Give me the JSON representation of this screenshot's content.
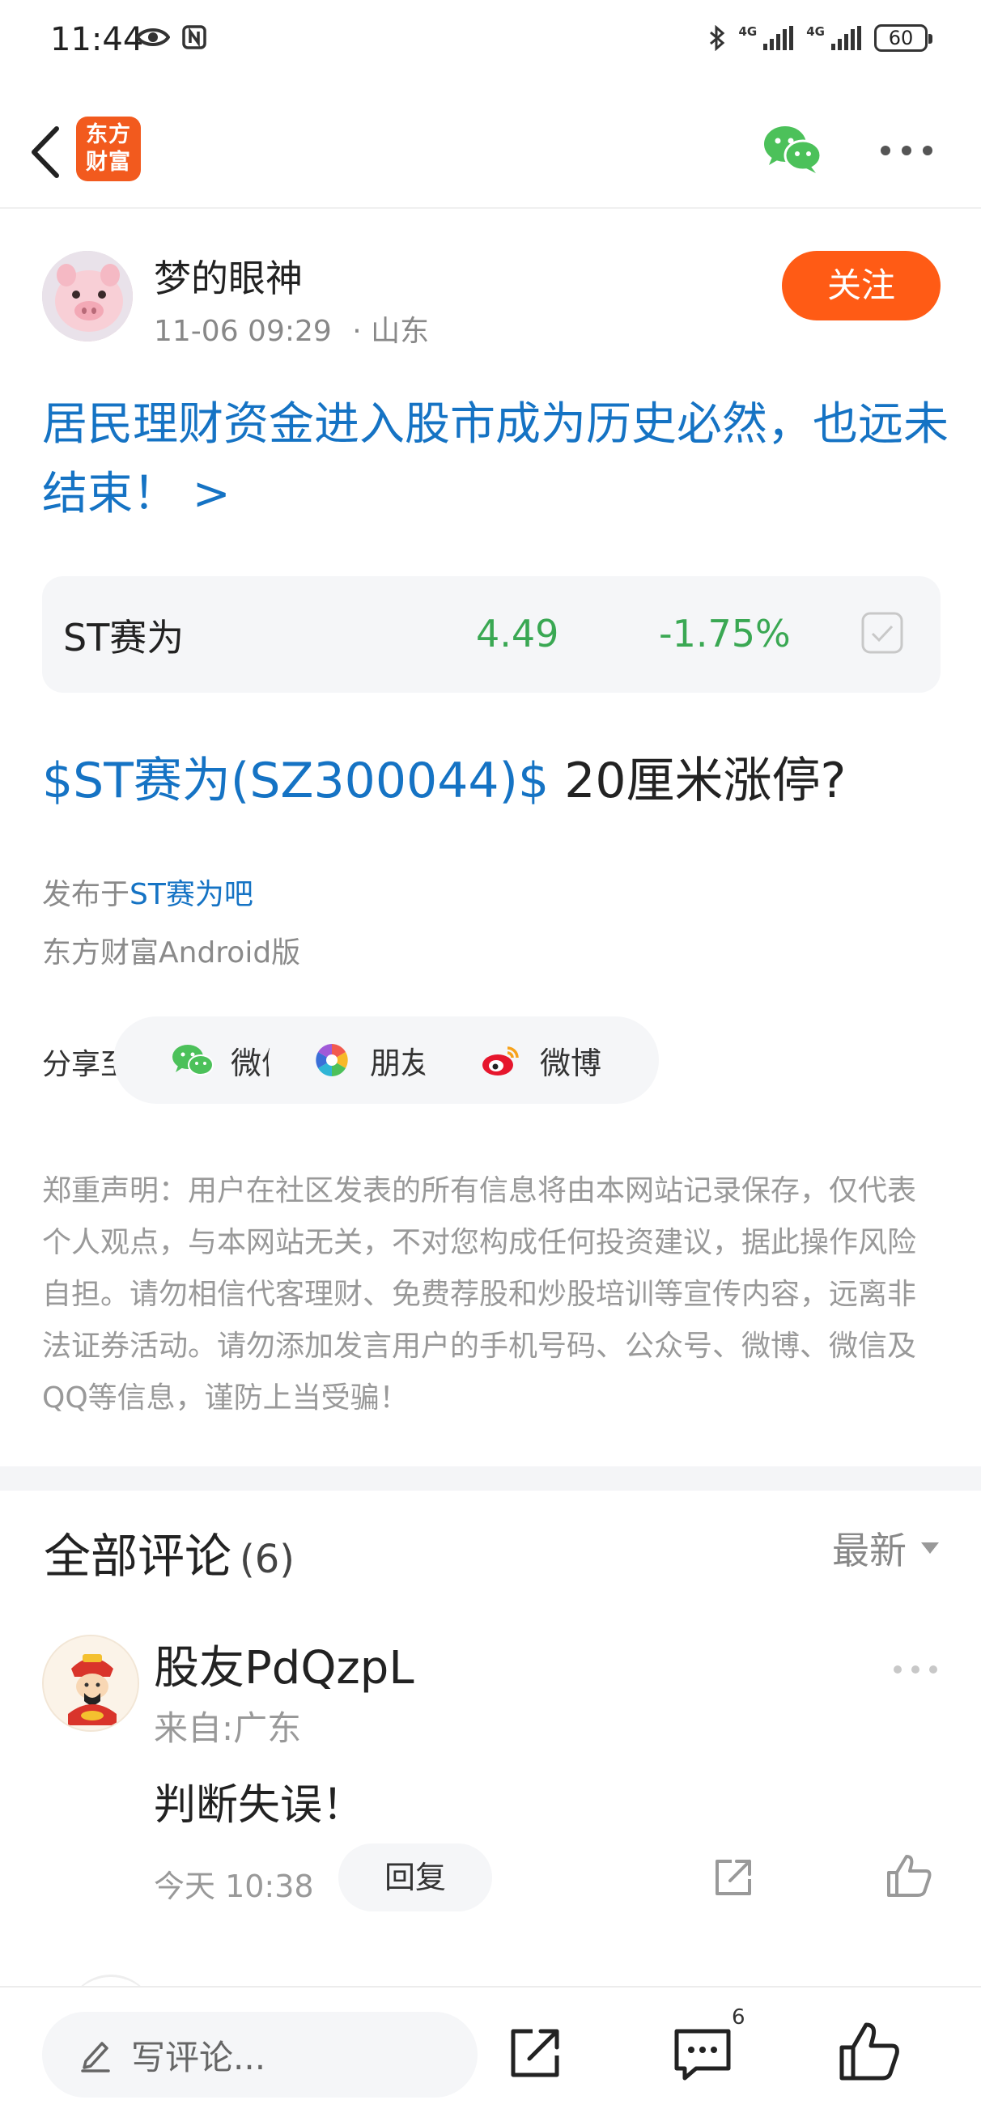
{
  "status_bar": {
    "time": "11:44",
    "network_1": "4G",
    "network_2": "4G",
    "battery": "60"
  },
  "nav": {
    "logo_text": "东方财富"
  },
  "author": {
    "name": "梦的眼神",
    "date": "11-06 09:29",
    "location": "· 山东",
    "follow_label": "关注"
  },
  "post": {
    "title": "居民理财资金进入股市成为历史必然，也远未结束！ >",
    "stock": {
      "name": "ST赛为",
      "price": "4.49",
      "change": "-1.75%"
    },
    "body_link": "$ST赛为(SZ300044)$",
    "body_text": " 20厘米涨停?",
    "published_prefix": "发布于",
    "published_forum": "ST赛为吧",
    "device": "东方财富Android版"
  },
  "share": {
    "label": "分享至:",
    "options": [
      {
        "label": "微信",
        "icon": "wechat-icon"
      },
      {
        "label": "朋友圈",
        "icon": "moments-icon"
      },
      {
        "label": "微博",
        "icon": "weibo-icon"
      }
    ]
  },
  "disclaimer": "郑重声明：用户在社区发表的所有信息将由本网站记录保存，仅代表个人观点，与本网站无关，不对您构成任何投资建议，据此操作风险自担。请勿相信代客理财、免费荐股和炒股培训等宣传内容，远离非法证券活动。请勿添加发言用户的手机号码、公众号、微博、微信及QQ等信息，谨防上当受骗！",
  "comments": {
    "title": "全部评论",
    "count": "(6)",
    "sort": "最新",
    "items": [
      {
        "user": "股友PdQzpL",
        "from": "来自:广东",
        "text": "判断失误！",
        "time": "今天 10:38",
        "reply_label": "回复"
      }
    ]
  },
  "bottom_bar": {
    "placeholder": "写评论...",
    "comment_badge": "6"
  },
  "colors": {
    "accent_blue": "#1573c4",
    "follow_orange": "#ff5b15",
    "stock_green": "#3aa853"
  }
}
